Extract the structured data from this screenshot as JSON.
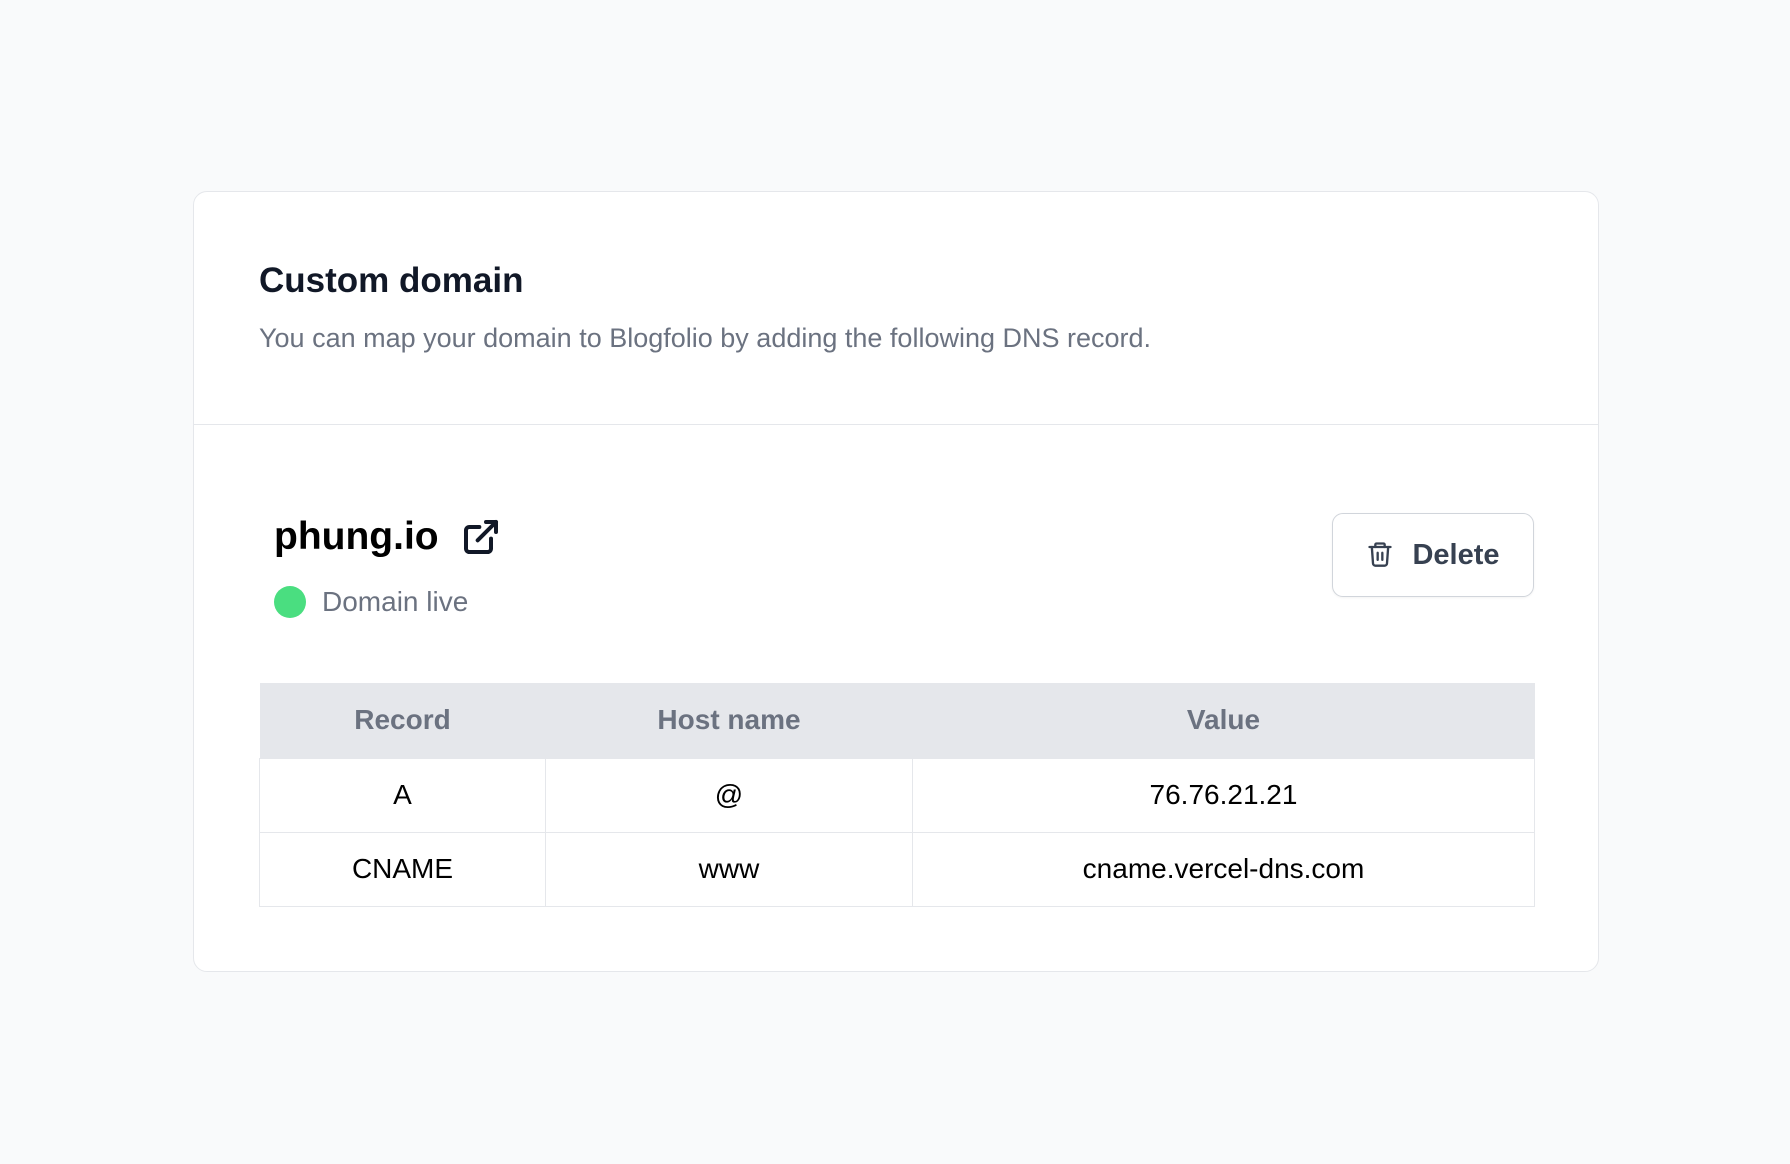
{
  "card": {
    "title": "Custom domain",
    "subtitle": "You can map your domain to Blogfolio by adding the following DNS record."
  },
  "domain": {
    "name": "phung.io",
    "external_icon": "external-link-icon",
    "status_label": "Domain live",
    "status_color": "#4ade80"
  },
  "actions": {
    "delete_label": "Delete",
    "delete_icon": "trash-icon"
  },
  "dns_table": {
    "headers": [
      "Record",
      "Host name",
      "Value"
    ],
    "rows": [
      [
        "A",
        "@",
        "76.76.21.21"
      ],
      [
        "CNAME",
        "www",
        "cname.vercel-dns.com"
      ]
    ]
  }
}
